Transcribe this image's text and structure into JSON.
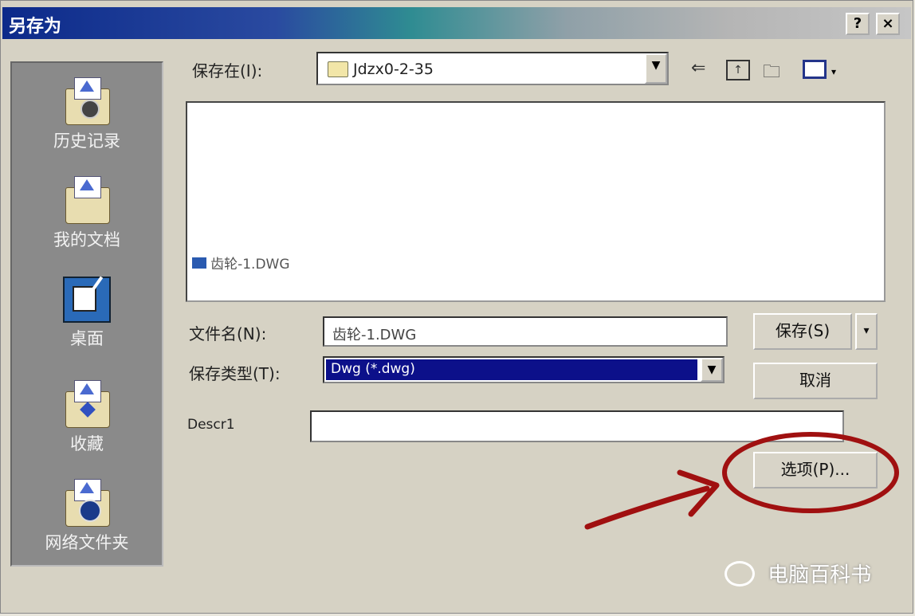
{
  "window": {
    "title": "另存为",
    "help_label": "?",
    "close_label": "×"
  },
  "places": [
    {
      "label": "历史记录",
      "icon": "history-icon"
    },
    {
      "label": "我的文档",
      "icon": "my-documents-icon"
    },
    {
      "label": "桌面",
      "icon": "desktop-icon"
    },
    {
      "label": "收藏",
      "icon": "favorites-icon"
    },
    {
      "label": "网络文件夹",
      "icon": "network-folder-icon"
    }
  ],
  "save_in": {
    "label": "保存在(I):",
    "value": "Jdzx0-2-35"
  },
  "toolbar": {
    "back_icon": "back-arrow-icon",
    "up_icon": "up-folder-icon",
    "new_folder_icon": "new-folder-icon",
    "views_icon": "views-menu-icon"
  },
  "file_list": {
    "items": [
      {
        "name": "齿轮-1.DWG"
      }
    ]
  },
  "file_name": {
    "label": "文件名(N):",
    "value": "齿轮-1.DWG"
  },
  "file_type": {
    "label": "保存类型(T):",
    "value": "Dwg (*.dwg)"
  },
  "desc": {
    "label": "Descr1",
    "value": ""
  },
  "buttons": {
    "save": "保存(S)",
    "cancel": "取消",
    "options": "选项(P)..."
  },
  "annotation": {
    "color": "#a01010"
  },
  "watermark": {
    "text": "电脑百科书"
  }
}
